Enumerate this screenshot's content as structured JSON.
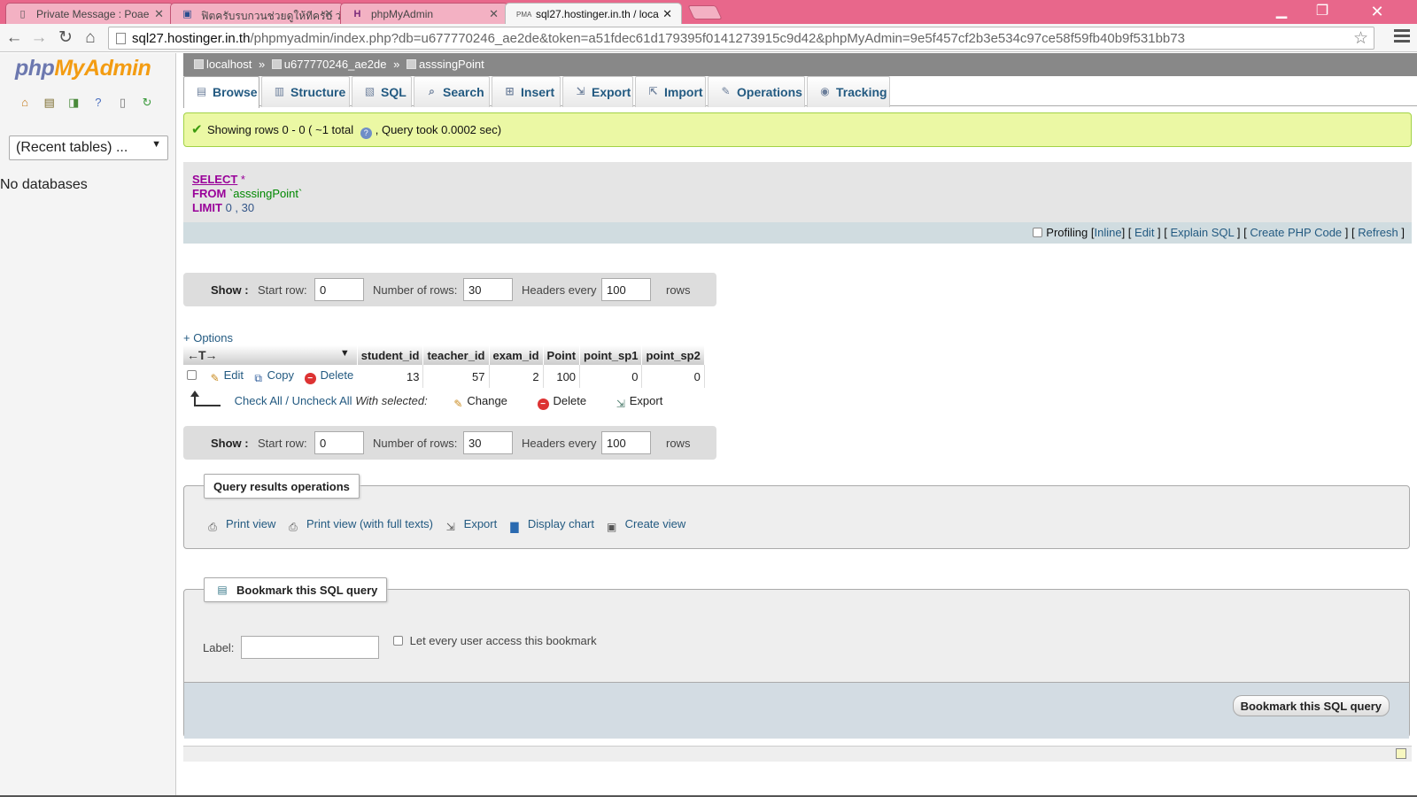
{
  "browser": {
    "tabs": [
      {
        "title": "Private Message : Poae",
        "icon": "page-icon"
      },
      {
        "title": "ฟิตครับรบกวนช่วยดูให้ทีครับ ว่าท",
        "icon": "forum-icon"
      },
      {
        "title": "phpMyAdmin",
        "icon": "phpmyadmin-icon"
      },
      {
        "title": "sql27.hostinger.in.th / loca",
        "icon": "pma-icon"
      }
    ],
    "url_host": "sql27.hostinger.in.th",
    "url_path": "/phpmyadmin/index.php?db=u677770246_ae2de&token=a51fdec61d179395f0141273915c9d42&phpMyAdmin=9e5f457cf2b3e534c97ce58f59fb40b9f531bb73"
  },
  "sidebar": {
    "logo_php": "php",
    "logo_myadmin": "MyAdmin",
    "recent_tables": "(Recent tables) ...",
    "no_databases": "No databases"
  },
  "breadcrumb": {
    "server": "localhost",
    "database": "u677770246_ae2de",
    "table": "asssingPoint",
    "separator": "»"
  },
  "tabs": [
    "Browse",
    "Structure",
    "SQL",
    "Search",
    "Insert",
    "Export",
    "Import",
    "Operations",
    "Tracking"
  ],
  "message": {
    "part1": "Showing rows 0 - 0 ( ~1 total",
    "part2": ", Query took 0.0002 sec)"
  },
  "sql": {
    "select": "SELECT",
    "star": "*",
    "from": "FROM",
    "table": "`asssingPoint`",
    "limit": "LIMIT",
    "limit_start": "0",
    "limit_sep": ",",
    "limit_count": "30"
  },
  "sql_links": {
    "profiling": "Profiling",
    "inline": "Inline",
    "edit": "Edit",
    "explain": "Explain SQL",
    "php_code": "Create PHP Code",
    "refresh": "Refresh"
  },
  "show": {
    "label": "Show :",
    "start_row_label": "Start row:",
    "start_row": "0",
    "num_rows_label": "Number of rows:",
    "num_rows": "30",
    "headers_label": "Headers every",
    "headers_every": "100",
    "rows_label": "rows"
  },
  "options_link": "+ Options",
  "table": {
    "arrows": "←T→",
    "columns": [
      "student_id",
      "teacher_id",
      "exam_id",
      "Point",
      "point_sp1",
      "point_sp2"
    ],
    "rows": [
      {
        "cells": [
          "13",
          "57",
          "2",
          "100",
          "0",
          "0"
        ]
      }
    ],
    "row_actions": {
      "edit": "Edit",
      "copy": "Copy",
      "delete": "Delete"
    }
  },
  "with_selected": {
    "check_all": "Check All / Uncheck All",
    "with_selected": "With selected:",
    "change": "Change",
    "delete": "Delete",
    "export": "Export"
  },
  "query_ops": {
    "legend": "Query results operations",
    "print_view": "Print view",
    "print_view_full": "Print view (with full texts)",
    "export": "Export",
    "display_chart": "Display chart",
    "create_view": "Create view"
  },
  "bookmark": {
    "legend": "Bookmark this SQL query",
    "label": "Label:",
    "everyone": "Let every user access this bookmark",
    "button": "Bookmark this SQL query"
  }
}
